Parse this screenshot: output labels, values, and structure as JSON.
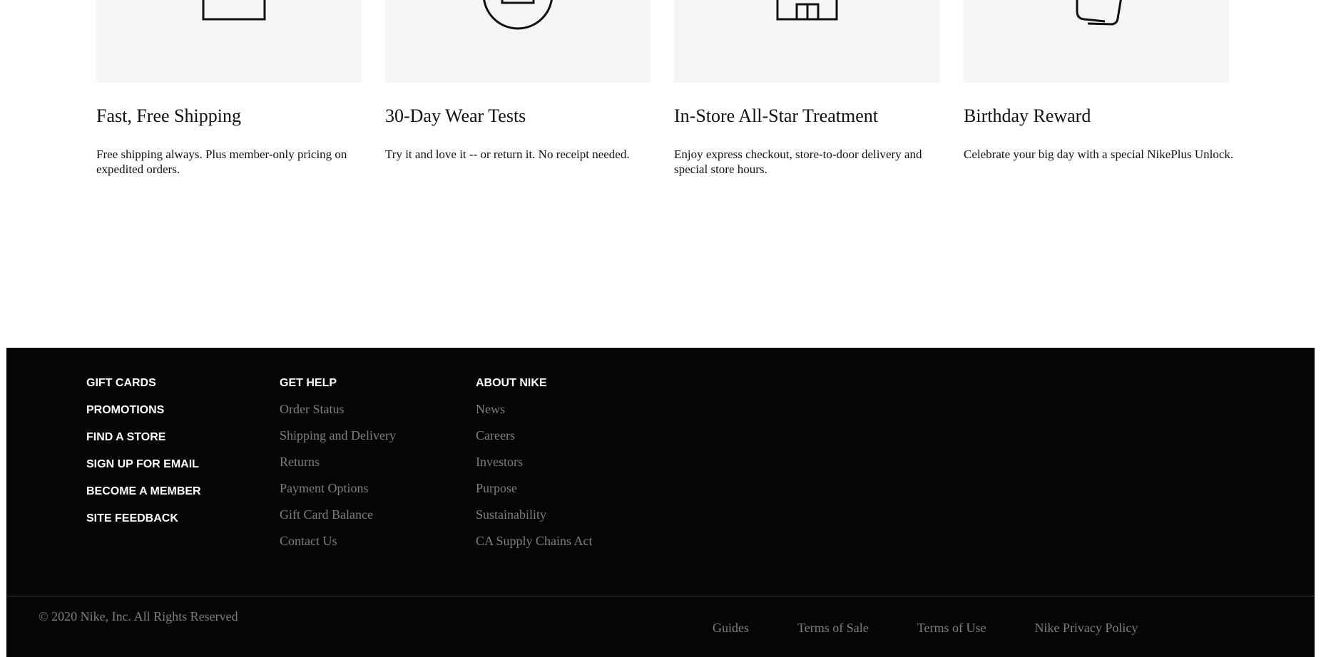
{
  "benefits": [
    {
      "icon": "shipping-box-icon",
      "title": "Fast, Free Shipping",
      "description": "Free shipping always. Plus member-only pricing on expedited orders."
    },
    {
      "icon": "shoe-test-circle-icon",
      "title": "30-Day Wear Tests",
      "description": "Try it and love it -- or return it. No receipt needed."
    },
    {
      "icon": "store-icon",
      "title": "In-Store All-Star Treatment",
      "description": "Enjoy express checkout, store-to-door delivery and special store hours."
    },
    {
      "icon": "gift-card-icon",
      "title": "Birthday Reward",
      "description": "Celebrate your big day with a special NikePlus Unlock."
    }
  ],
  "footer": {
    "main_links": [
      "GIFT CARDS",
      "PROMOTIONS",
      "FIND A STORE",
      "SIGN UP FOR EMAIL",
      "BECOME A MEMBER",
      "SITE FEEDBACK"
    ],
    "get_help": {
      "heading": "GET HELP",
      "links": [
        "Order Status",
        "Shipping and Delivery",
        "Returns",
        "Payment Options",
        "Gift Card Balance",
        "Contact Us"
      ]
    },
    "about": {
      "heading": "ABOUT NIKE",
      "links": [
        "News",
        "Careers",
        "Investors",
        "Purpose",
        "Sustainability",
        "CA Supply Chains Act"
      ]
    },
    "copyright": "© 2020 Nike, Inc. All Rights Reserved",
    "legal_links": [
      "Guides",
      "Terms of Sale",
      "Terms of Use",
      "Nike Privacy Policy"
    ]
  },
  "colors": {
    "footer_bg": "#050505",
    "footer_muted": "#7e7e7e",
    "card_bg": "#f5f5f5"
  }
}
